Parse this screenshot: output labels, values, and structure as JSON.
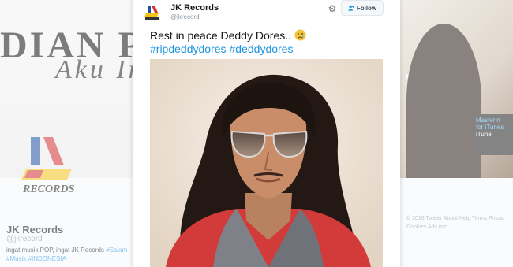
{
  "background": {
    "banner_title": "DIAN PIE",
    "banner_subtitle": "Aku In",
    "profile_name": "JK Records",
    "profile_handle": "@jkrecord",
    "bio_text": "ingat musik POP, ingat JK Records",
    "bio_tags": [
      "#Salam",
      "#Musik",
      "#INDONESIA"
    ],
    "itunes_line1": "Masterin",
    "itunes_line2": "for iTunes",
    "itunes_badge": "iTune",
    "footer_lines": [
      "© 2016 Twitter  About  Help  Terms  Privac",
      "Cookies  Ads info"
    ],
    "nav_arrow": "›",
    "logo_text": "RECORDS"
  },
  "tweet": {
    "author_name": "JK Records",
    "author_handle": "@jkrecord",
    "follow_label": "Follow",
    "text": "Rest in peace Deddy Dores..",
    "hashtags": [
      "#ripdeddydores",
      "#deddydores"
    ],
    "emoji": "crying-face"
  },
  "colors": {
    "link": "#1b95e0",
    "logo_red": "#d32f2f",
    "logo_blue": "#1e4fa0",
    "logo_yellow": "#f3c318"
  },
  "icons": {
    "gear": "gear-icon",
    "follow": "add-user-icon"
  }
}
